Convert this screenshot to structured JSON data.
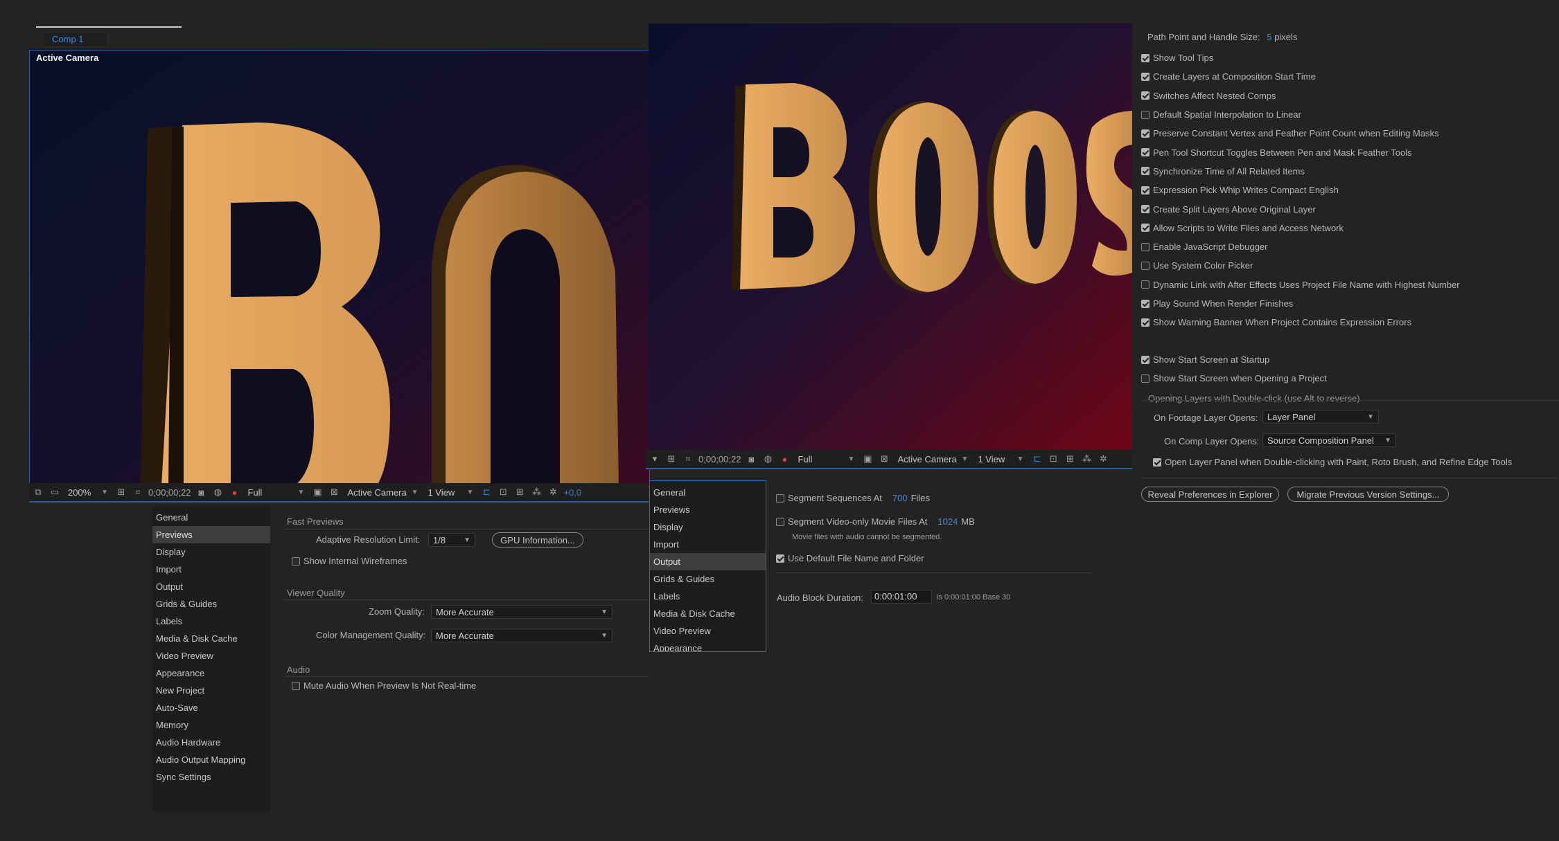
{
  "comp_tab": {
    "label": "Comp 1"
  },
  "viewer_left": {
    "camera_label": "Active Camera",
    "letters": "BO"
  },
  "viewer_right": {
    "letters": "BOOS"
  },
  "toolbar_left": {
    "zoom": "200%",
    "timecode": "0;00;00;22",
    "resolution": "Full",
    "camera": "Active Camera",
    "views": "1 View",
    "exposure": "+0,0"
  },
  "toolbar_right": {
    "timecode": "0;00;00;22",
    "resolution": "Full",
    "camera": "Active Camera",
    "views": "1 View"
  },
  "categories_left": {
    "items": [
      "General",
      "Previews",
      "Display",
      "Import",
      "Output",
      "Grids & Guides",
      "Labels",
      "Media & Disk Cache",
      "Video Preview",
      "Appearance",
      "New Project",
      "Auto-Save",
      "Memory",
      "Audio Hardware",
      "Audio Output Mapping",
      "Sync Settings"
    ],
    "selected": "Previews"
  },
  "categories_right": {
    "items": [
      "General",
      "Previews",
      "Display",
      "Import",
      "Output",
      "Grids & Guides",
      "Labels",
      "Media & Disk Cache",
      "Video Preview",
      "Appearance"
    ],
    "selected": "Output"
  },
  "previews": {
    "fast_previews_heading": "Fast Previews",
    "adaptive_label": "Adaptive Resolution Limit:",
    "adaptive_value": "1/8",
    "gpu_button": "GPU Information...",
    "wireframes_label": "Show Internal Wireframes",
    "viewer_quality_heading": "Viewer Quality",
    "zoom_quality_label": "Zoom Quality:",
    "zoom_quality_value": "More Accurate",
    "color_mgmt_label": "Color Management Quality:",
    "color_mgmt_value": "More Accurate",
    "audio_heading": "Audio",
    "mute_label": "Mute Audio When Preview Is Not Real-time"
  },
  "output": {
    "segment_seq_label": "Segment Sequences At",
    "segment_seq_value": "700",
    "segment_seq_unit": "Files",
    "segment_video_label": "Segment Video-only Movie Files At",
    "segment_video_value": "1024",
    "segment_video_unit": "MB",
    "audio_note": "Movie files with audio cannot be segmented.",
    "default_name_label": "Use Default File Name and Folder",
    "audio_block_label": "Audio Block Duration:",
    "audio_block_value": "0:00:01:00",
    "audio_block_note": "is 0:00:01:00  Base 30"
  },
  "general": {
    "path_point_label": "Path Point and Handle Size:",
    "path_point_value": "5",
    "path_point_unit": "pixels",
    "checks": [
      {
        "label": "Show Tool Tips",
        "on": true
      },
      {
        "label": "Create Layers at Composition Start Time",
        "on": true
      },
      {
        "label": "Switches Affect Nested Comps",
        "on": true
      },
      {
        "label": "Default Spatial Interpolation to Linear",
        "on": false
      },
      {
        "label": "Preserve Constant Vertex and Feather Point Count when Editing Masks",
        "on": true
      },
      {
        "label": "Pen Tool Shortcut Toggles Between Pen and Mask Feather Tools",
        "on": true
      },
      {
        "label": "Synchronize Time of All Related Items",
        "on": true
      },
      {
        "label": "Expression Pick Whip Writes Compact English",
        "on": true
      },
      {
        "label": "Create Split Layers Above Original Layer",
        "on": true
      },
      {
        "label": "Allow Scripts to Write Files and Access Network",
        "on": true
      },
      {
        "label": "Enable JavaScript Debugger",
        "on": false
      },
      {
        "label": "Use System Color Picker",
        "on": false
      },
      {
        "label": "Dynamic Link with After Effects Uses Project File Name with Highest Number",
        "on": false
      },
      {
        "label": "Play Sound When Render Finishes",
        "on": true
      },
      {
        "label": "Show Warning Banner When Project Contains Expression Errors",
        "on": true
      }
    ],
    "start_screen_label": "Show Start Screen at Startup",
    "start_screen_on": true,
    "start_screen_open_label": "Show Start Screen when Opening a Project",
    "start_screen_open_on": false,
    "double_click_heading": "Opening Layers with Double-click (use Alt to reverse)",
    "footage_label": "On Footage Layer Opens:",
    "footage_value": "Layer Panel",
    "comp_label": "On Comp Layer Opens:",
    "comp_value": "Source Composition Panel",
    "open_layer_panel_label": "Open Layer Panel when Double-clicking with Paint, Roto Brush, and Refine Edge Tools",
    "reveal_button": "Reveal Preferences in Explorer",
    "migrate_button": "Migrate Previous Version Settings..."
  },
  "colors": {
    "accent_blue": "#2f86d6",
    "letter_gold": "#e5a55d",
    "bg_navy": "#0b0f26",
    "bg_red": "#6a0616"
  }
}
